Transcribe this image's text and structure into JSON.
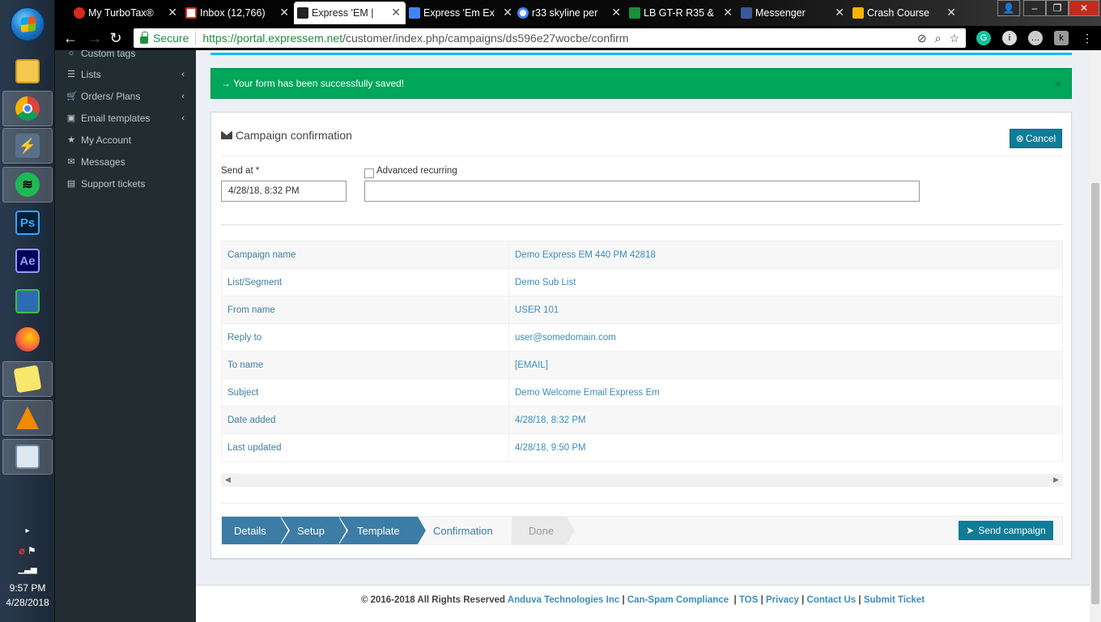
{
  "taskbar": {
    "apps": [
      "file-explorer",
      "chrome",
      "putty",
      "spotify",
      "photoshop",
      "after-effects",
      "network-tool",
      "firefox",
      "sticky-notes",
      "vlc",
      "calculator"
    ],
    "photoshop_label": "Ps",
    "ae_label": "Ae",
    "time": "9:57 PM",
    "date": "4/28/2018"
  },
  "tabs": [
    {
      "label": "My TurboTax®",
      "color": "#d52b1e"
    },
    {
      "label": "Inbox (12,766)",
      "color": "#d93025"
    },
    {
      "label": "Express 'EM |",
      "color": "#222222"
    },
    {
      "label": "Express 'Em Ex",
      "color": "#4285f4"
    },
    {
      "label": "r33 skyline per",
      "color": "#ffffff"
    },
    {
      "label": "LB GT-R R35 &",
      "color": "#1a8f3c"
    },
    {
      "label": "Messenger",
      "color": "#3b5998"
    },
    {
      "label": "Crash Course",
      "color": "#f4b400"
    }
  ],
  "browser": {
    "secure_label": "Secure",
    "url_host": "https://portal.expressem.net",
    "url_path": "/customer/index.php/campaigns/ds596e27wocbe/confirm"
  },
  "sidebar": {
    "partial_item": "Custom tags",
    "items": [
      {
        "label": "Lists",
        "icon": "list-icon",
        "caret": "‹"
      },
      {
        "label": "Orders/ Plans",
        "icon": "cart-icon",
        "caret": "‹"
      },
      {
        "label": "Email templates",
        "icon": "image-icon",
        "caret": "‹"
      },
      {
        "label": "My Account",
        "icon": "star-icon"
      },
      {
        "label": "Messages",
        "icon": "envelope-icon"
      },
      {
        "label": "Support tickets",
        "icon": "ticket-icon"
      }
    ]
  },
  "alert": {
    "message": "→ Your form has been successfully saved!",
    "close": "×"
  },
  "box": {
    "title": "Campaign confirmation",
    "cancel_label": "Cancel",
    "send_at_label": "Send at *",
    "send_at_value": "4/28/18, 8:32 PM",
    "recurring_label": "Advanced recurring",
    "recurring_value": ""
  },
  "details": [
    {
      "key": "Campaign name",
      "value": "Demo Express EM 440 PM 42818"
    },
    {
      "key": "List/Segment",
      "value": "Demo Sub List"
    },
    {
      "key": "From name",
      "value": "USER 101"
    },
    {
      "key": "Reply to",
      "value": "user@somedomain.com"
    },
    {
      "key": "To name",
      "value": "[EMAIL]"
    },
    {
      "key": "Subject",
      "value": "Demo Welcome Email Express Em"
    },
    {
      "key": "Date added",
      "value": "4/28/18, 8:32 PM"
    },
    {
      "key": "Last updated",
      "value": "4/28/18, 9:50 PM"
    }
  ],
  "wizard": {
    "steps": [
      "Details",
      "Setup",
      "Template",
      "Confirmation",
      "Done"
    ],
    "current": "Confirmation",
    "send_label": "Send campaign"
  },
  "footer": {
    "prefix": "© 2016-2018 All Rights Reserved",
    "company": "Anduva Technologies Inc",
    "links": [
      "Can-Spam Compliance",
      "TOS",
      "Privacy",
      "Contact Us",
      "Submit Ticket"
    ]
  }
}
